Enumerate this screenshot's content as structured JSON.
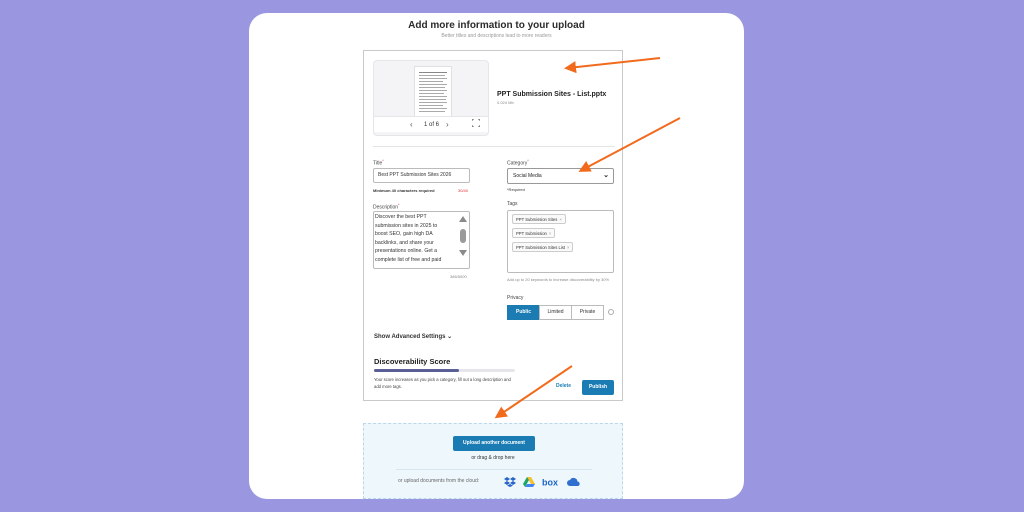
{
  "dialog": {
    "title": "Add more information to your upload",
    "subtitle": "Better titles and descriptions lead to more readers"
  },
  "file": {
    "name": "PPT Submission Sites - List.pptx",
    "size": "0.024 Mb",
    "pager": {
      "prev_icon": "chevron-left",
      "next_icon": "chevron-right",
      "label": "1 of 6",
      "fullscreen_icon": "fullscreen"
    }
  },
  "form": {
    "title_label": "Title",
    "title_value": "Best PPT Submission Sites 2026",
    "title_hint": "Minimum 40 characters required",
    "title_counter": "30/40",
    "description_label": "Description",
    "description_value": "Discover the best PPT submission sites in 2025 to boost SEO, gain high DA backlinks, and share your presentations online. Get a complete list of free and paid",
    "description_counter": "386/5000",
    "category_label": "Category",
    "category_value": "Social Media",
    "category_required": "*Required",
    "tags_label": "Tags",
    "tags": [
      "PPT Submission Sites",
      "PPT Submission",
      "PPT Submission Sites List"
    ],
    "tags_hint": "Add up to 20 keywords to increase discoverability by 30%",
    "privacy_label": "Privacy",
    "privacy_options": [
      "Public",
      "Limited",
      "Private"
    ],
    "privacy_selected": "Public"
  },
  "advanced": {
    "label": "Show Advanced Settings"
  },
  "discoverability": {
    "title": "Discoverability Score",
    "progress_fraction": 0.6,
    "description": "Your score increases as you pick a category, fill out a long description and add more tags."
  },
  "actions": {
    "delete": "Delete",
    "publish": "Publish"
  },
  "upload": {
    "button": "Upload another document",
    "drag_text": "or drag & drop here",
    "cloud_text": "or upload documents from the cloud:",
    "cloud_services": [
      "dropbox-icon",
      "google-drive-icon",
      "box-icon",
      "onedrive-icon"
    ]
  },
  "colors": {
    "background": "#9a97e0",
    "accent": "#1b7cb3",
    "arrow": "#f26a1b",
    "score_fill": "#5a5f95"
  }
}
